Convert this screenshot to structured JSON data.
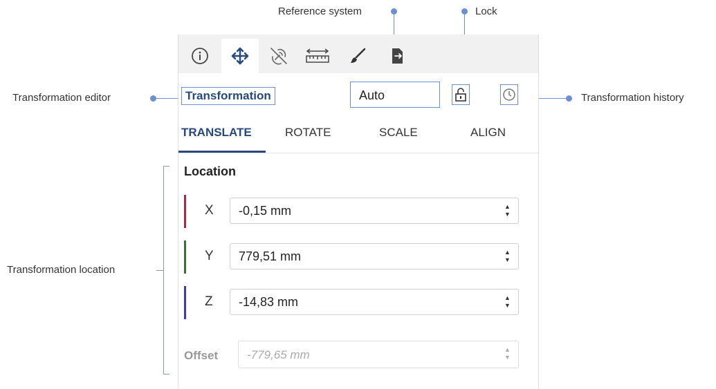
{
  "annotations": {
    "reference_system": "Reference system",
    "lock": "Lock",
    "transformation_editor": "Transformation editor",
    "transformation_history": "Transformation history",
    "transformation_location": "Transformation location"
  },
  "toolbar": {
    "icons": [
      "info-icon",
      "move-icon",
      "no-satellite-icon",
      "ruler-icon",
      "brush-icon",
      "export-document-icon"
    ],
    "active": "move-icon"
  },
  "editor": {
    "title": "Transformation",
    "reference_system": "Auto"
  },
  "tabs": [
    {
      "label": "TRANSLATE",
      "active": true
    },
    {
      "label": "ROTATE",
      "active": false
    },
    {
      "label": "SCALE",
      "active": false
    },
    {
      "label": "ALIGN",
      "active": false
    }
  ],
  "location": {
    "label": "Location",
    "axes": [
      {
        "axis": "X",
        "value": "-0,15 mm",
        "color": "#9b2d4f"
      },
      {
        "axis": "Y",
        "value": "779,51 mm",
        "color": "#3e6b3a"
      },
      {
        "axis": "Z",
        "value": "-14,83 mm",
        "color": "#3b3bb0"
      }
    ]
  },
  "offset": {
    "label": "Offset",
    "value": "-779,65 mm"
  },
  "colors": {
    "accent": "#6b8fd1",
    "title_text": "#27497b"
  }
}
